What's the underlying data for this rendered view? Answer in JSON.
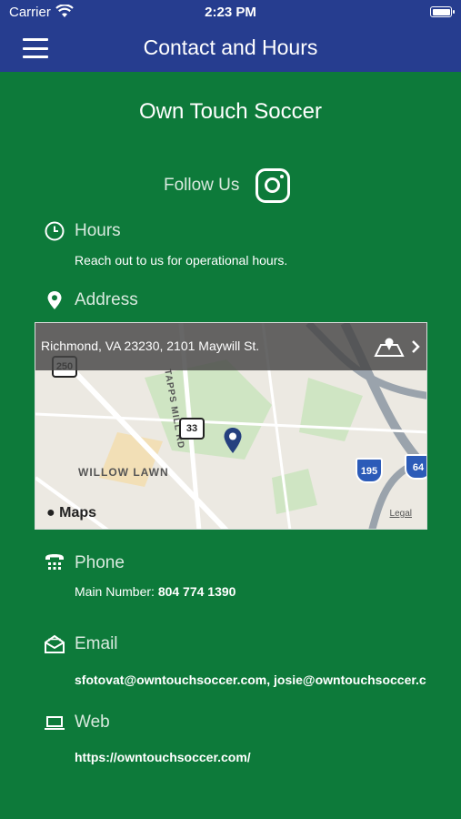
{
  "status_bar": {
    "carrier": "Carrier",
    "time": "2:23 PM"
  },
  "nav": {
    "title": "Contact and Hours"
  },
  "brand": "Own Touch Soccer",
  "follow": {
    "label": "Follow Us"
  },
  "hours": {
    "label": "Hours",
    "text": "Reach out to us for operational hours."
  },
  "address": {
    "label": "Address",
    "map": {
      "address_text": "Richmond, VA 23230, 2101 Maywill St.",
      "street_labels": [
        "WILLOW LAWN",
        "TAPPS MILL RD"
      ],
      "route_shields": [
        "250",
        "33"
      ],
      "interstate_shields": [
        "195",
        "64"
      ],
      "logo": "Maps",
      "legal": "Legal"
    }
  },
  "phone": {
    "label": "Phone",
    "prefix": "Main Number:",
    "number": "804 774 1390"
  },
  "email": {
    "label": "Email",
    "value": "sfotovat@owntouchsoccer.com, josie@owntouchsoccer.com"
  },
  "web": {
    "label": "Web",
    "value": "https://owntouchsoccer.com/"
  },
  "colors": {
    "background": "#0d7a3a",
    "nav": "#263d8f",
    "pin": "#25407f"
  }
}
